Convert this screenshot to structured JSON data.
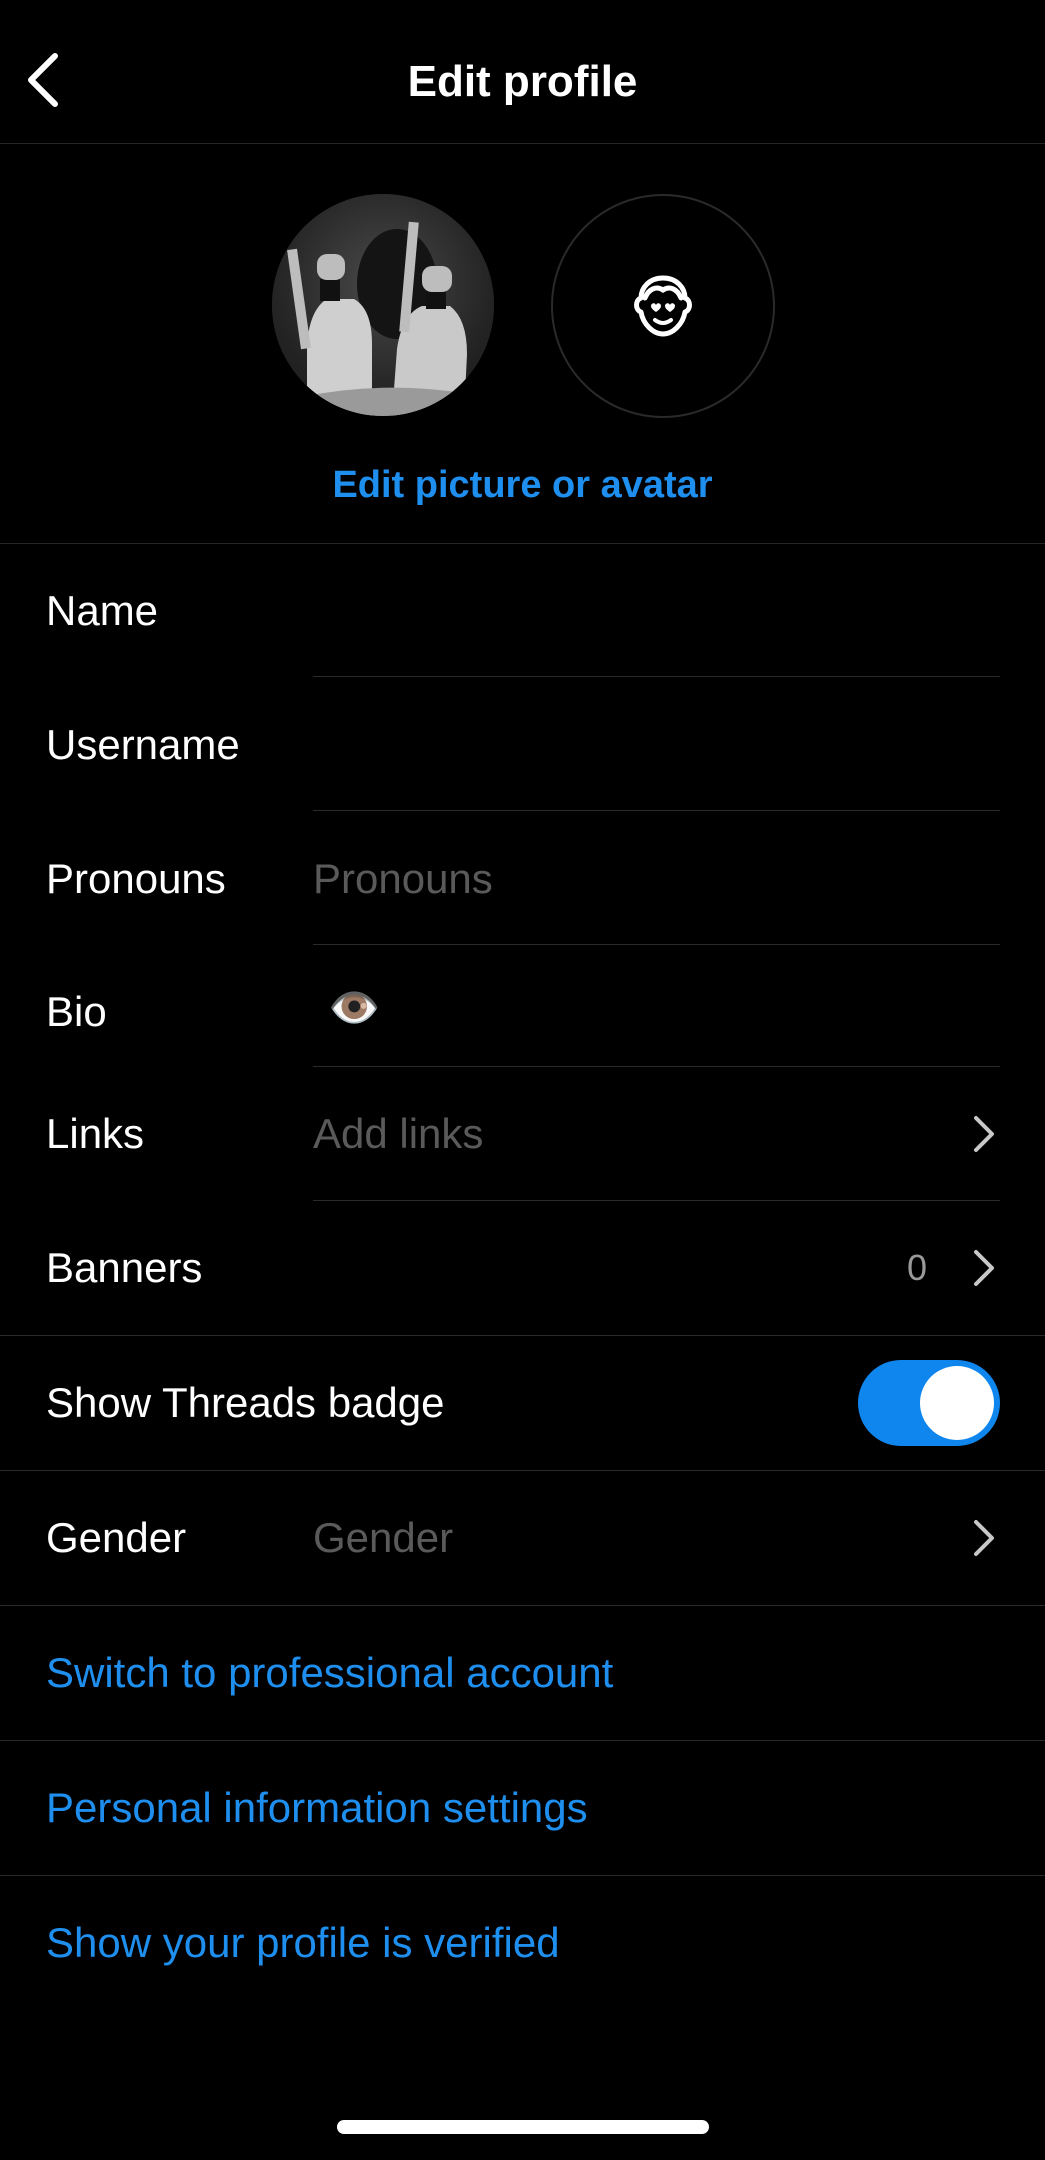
{
  "header": {
    "title": "Edit profile",
    "back_icon": "chevron-left-icon"
  },
  "avatar_section": {
    "edit_link": "Edit picture or avatar",
    "avatar_icon": "avatar-face-icon"
  },
  "fields": {
    "name": {
      "label": "Name",
      "value": ""
    },
    "username": {
      "label": "Username",
      "value": ""
    },
    "pronouns": {
      "label": "Pronouns",
      "placeholder": "Pronouns"
    },
    "bio": {
      "label": "Bio",
      "value": "👁️"
    },
    "links": {
      "label": "Links",
      "placeholder": "Add links",
      "icon": "chevron-right-icon"
    },
    "banners": {
      "label": "Banners",
      "count": "0",
      "icon": "chevron-right-icon"
    }
  },
  "threads_badge": {
    "label": "Show Threads badge",
    "enabled": true
  },
  "gender": {
    "label": "Gender",
    "placeholder": "Gender",
    "icon": "chevron-right-icon"
  },
  "links": {
    "professional": "Switch to professional account",
    "personal_info": "Personal information settings",
    "verified": "Show your profile is verified"
  },
  "colors": {
    "background": "#000000",
    "accent_blue": "#1f8fef",
    "toggle_on": "#0f85ee",
    "placeholder": "#5a5a5a",
    "divider": "#2a2a2a"
  }
}
